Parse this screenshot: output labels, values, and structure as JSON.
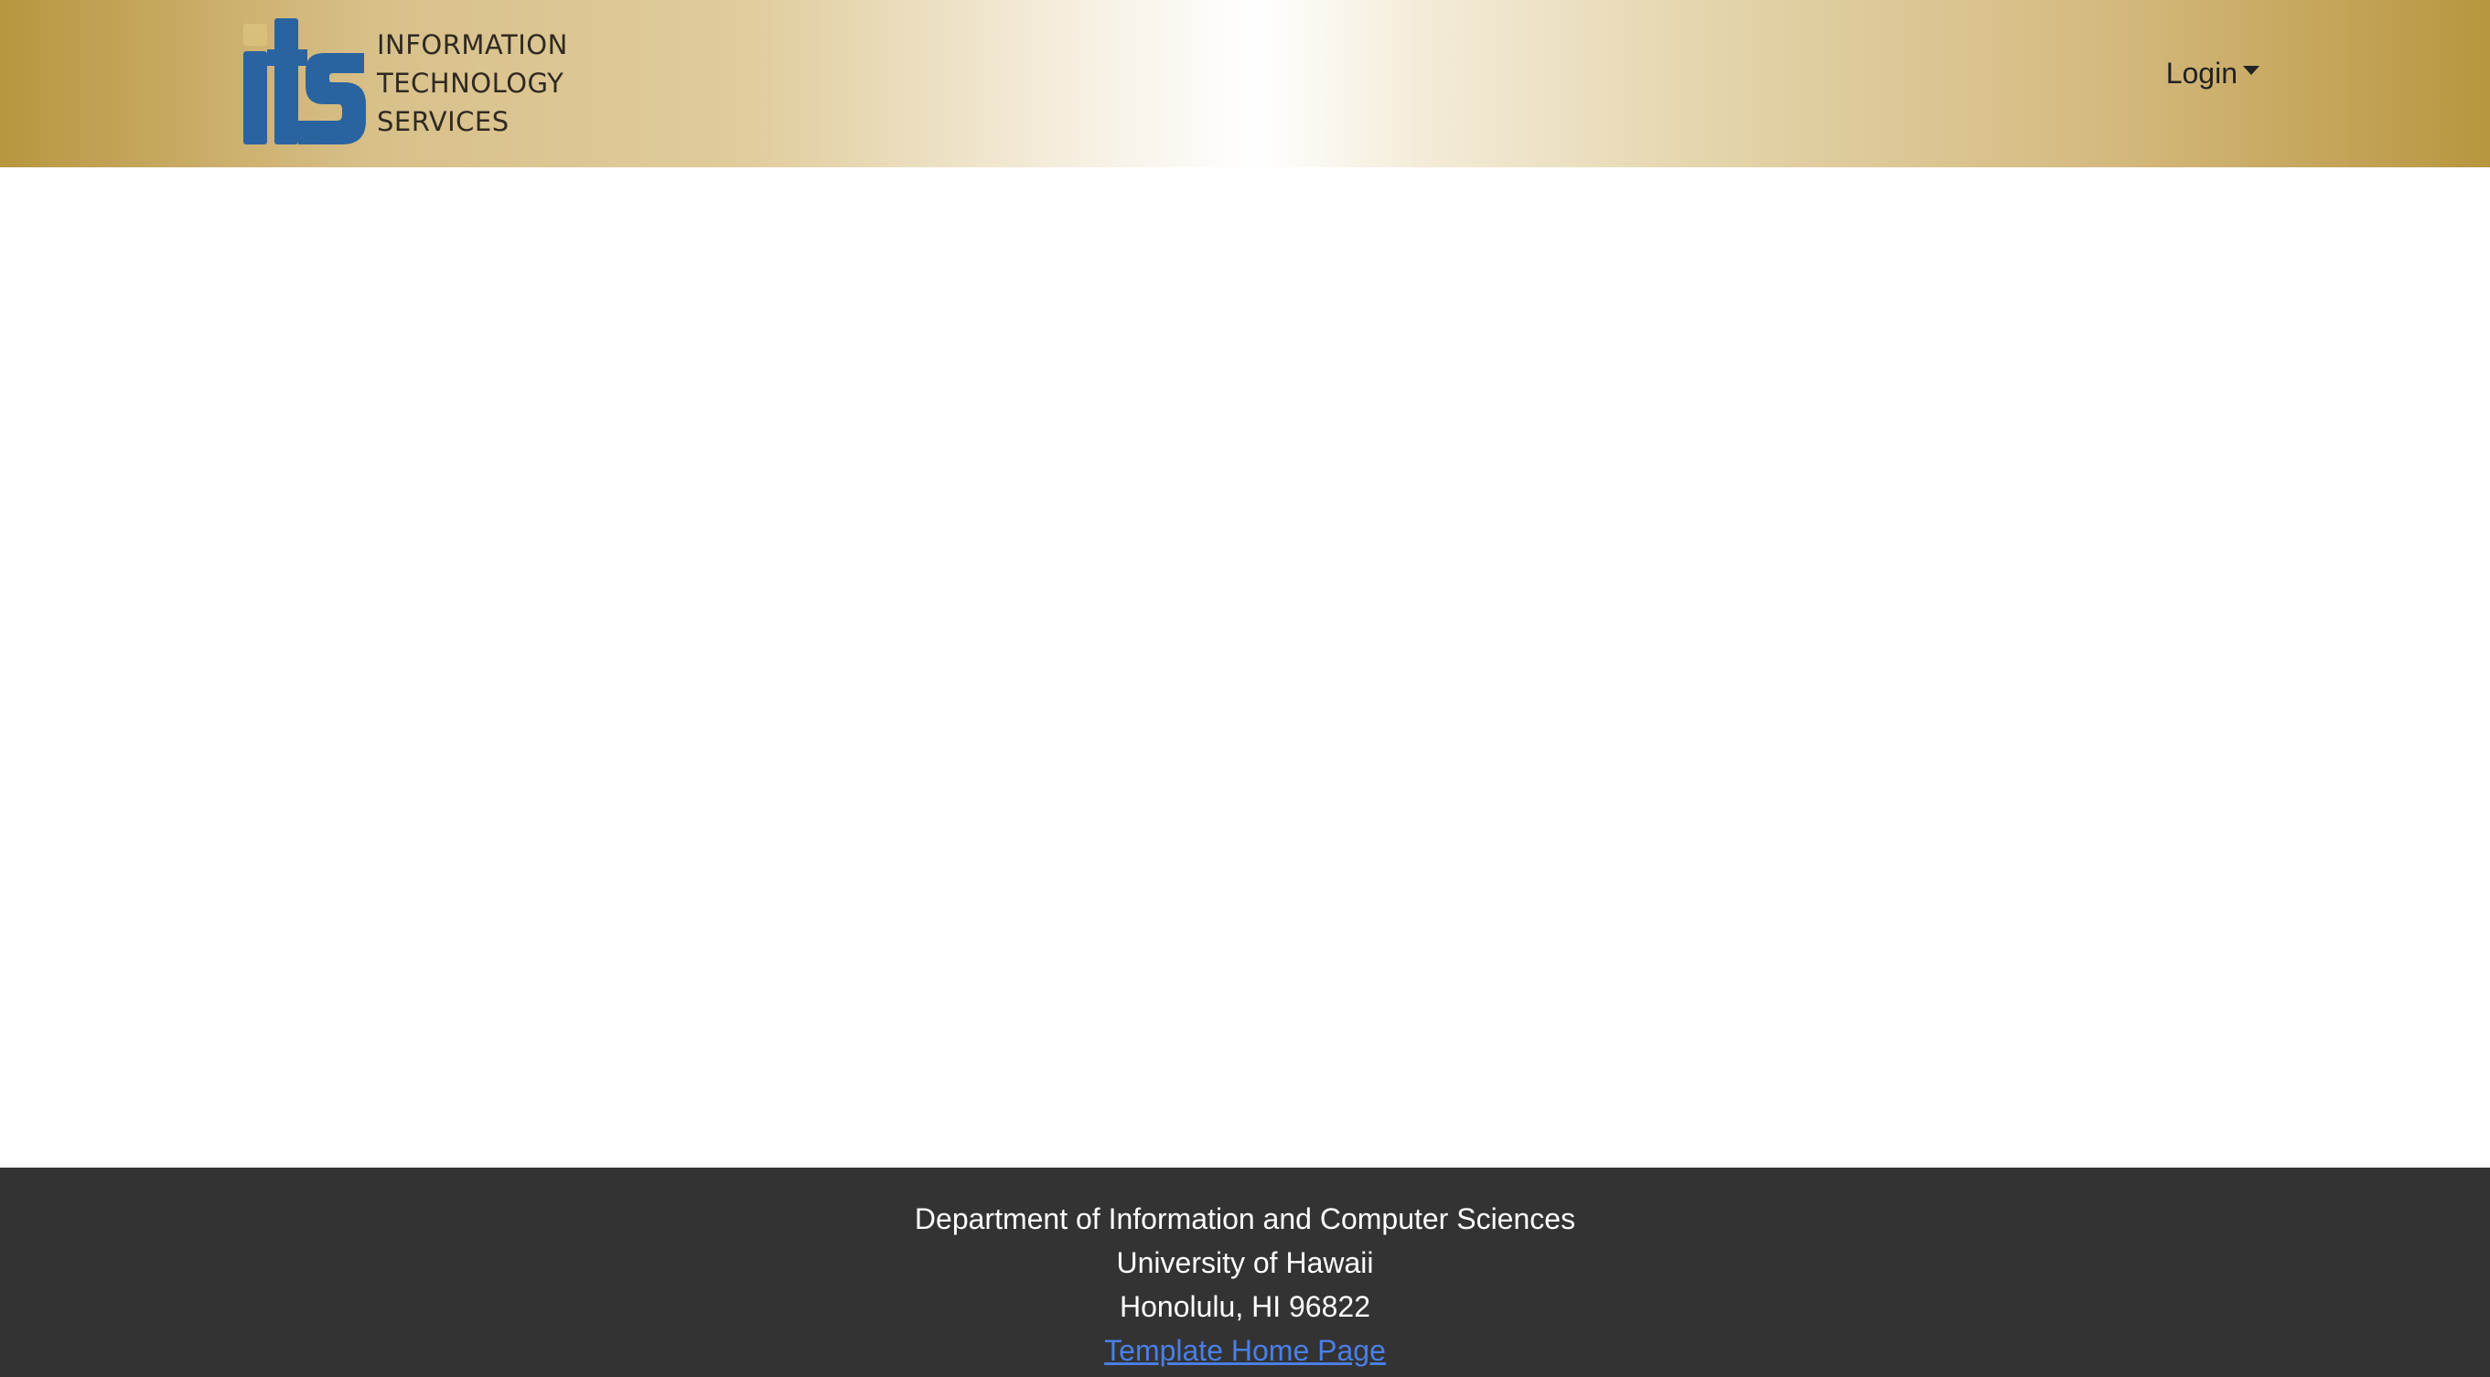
{
  "header": {
    "logo": {
      "mark_text": "its",
      "lines": [
        "INFORMATION",
        "TECHNOLOGY",
        "SERVICES"
      ],
      "mark_color": "#2a64a0"
    },
    "login_label": "Login"
  },
  "footer": {
    "department": "Department of Information and Computer Sciences",
    "university": "University of Hawaii",
    "address": "Honolulu, HI 96822",
    "link_label": "Template Home Page",
    "link_color": "#4a7fe6",
    "background": "#333333"
  }
}
